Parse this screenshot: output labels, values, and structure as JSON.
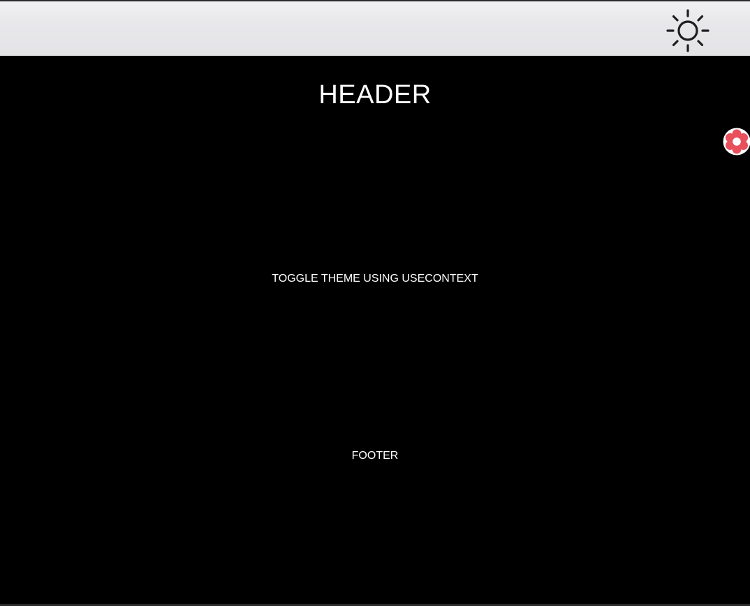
{
  "navbar": {
    "toggle_icon": "sun-icon",
    "background": "#e6e5e8",
    "icon_color": "#1f1f1f"
  },
  "main": {
    "header_title": "HEADER",
    "body_text": "TOGGLE THEME USING USECONTEXT",
    "footer_text": "FOOTER",
    "background": "#000000",
    "text_color": "#ffffff"
  },
  "floating_widget": {
    "icon": "flower-badge-icon",
    "color": "#e8505b"
  }
}
